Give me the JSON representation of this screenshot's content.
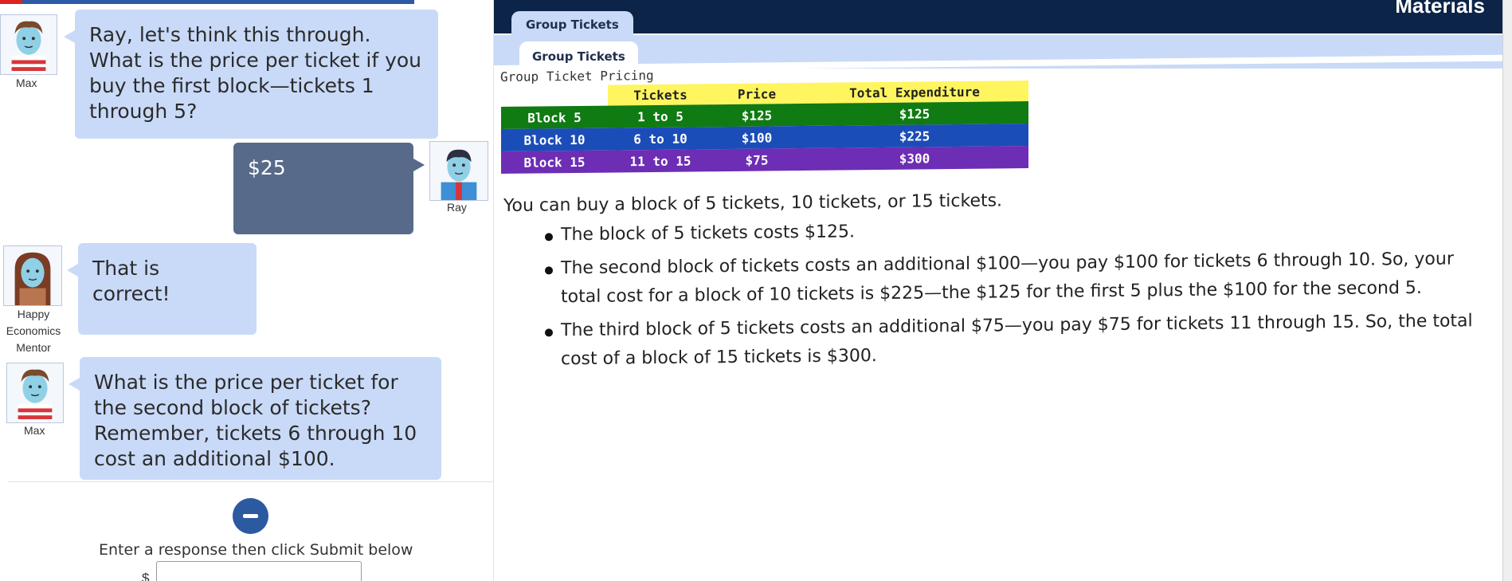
{
  "chat": {
    "messages": [
      {
        "speaker": "Max",
        "text": "Ray, let's think this through.  What is the price per ticket if you buy the first block—tickets 1 through 5?"
      },
      {
        "speaker": "Ray",
        "text": "$25"
      },
      {
        "speaker_lines": [
          "Happy",
          "Economics",
          "Mentor"
        ],
        "text": "That is correct!"
      },
      {
        "speaker": "Max",
        "text": "What is the price per ticket for the second block of tickets? Remember, tickets 6 through 10 cost an additional $100."
      }
    ],
    "response_prompt": "Enter a response then click Submit below",
    "currency_symbol": "$",
    "response_value": ""
  },
  "materials": {
    "title": "Materials",
    "outer_tab": "Group Tickets",
    "inner_tab": "Group Tickets",
    "table": {
      "caption": "Group Ticket Pricing",
      "headers": [
        "Tickets",
        "Price",
        "Total Expenditure"
      ],
      "rows": [
        {
          "block": "Block 5",
          "tickets": "1 to 5",
          "price": "$125",
          "total": "$125"
        },
        {
          "block": "Block 10",
          "tickets": "6 to 10",
          "price": "$100",
          "total": "$225"
        },
        {
          "block": "Block 15",
          "tickets": "11 to 15",
          "price": "$75",
          "total": "$300"
        }
      ]
    },
    "intro": "You can buy a block of 5 tickets, 10 tickets, or 15 tickets.",
    "bullets": [
      "The block of 5 tickets costs $125.",
      "The second block of tickets costs an additional $100—you pay $100 for tickets 6 through 10. So, your total cost for a block of 10 tickets is $225—the $125 for the first 5 plus the $100 for the second 5.",
      "The third block of 5 tickets costs an additional $75—you pay $75 for tickets 11 through 15. So, the total cost of a block of 15 tickets is $300."
    ]
  },
  "colors": {
    "chat_bubble": "#c9daf8",
    "user_bubble": "#576a8a",
    "header": "#0b2447",
    "row_block_5": "#0f7b12",
    "row_block_10": "#1b4db8",
    "row_block_15": "#6d2db4",
    "table_header": "#fff55f"
  }
}
